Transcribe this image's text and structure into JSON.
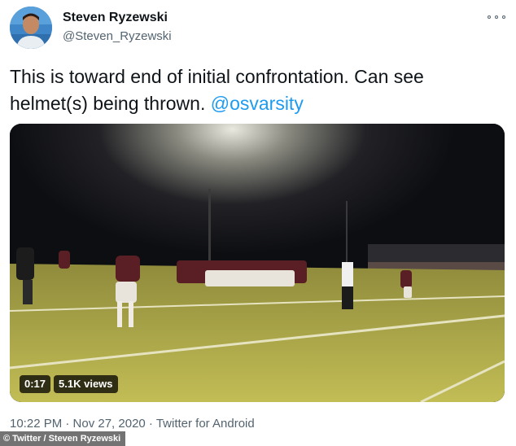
{
  "author": {
    "name": "Steven Ryzewski",
    "handle": "@Steven_Ryzewski",
    "avatar_icon": "profile-photo"
  },
  "tweet": {
    "text": "This is toward end of initial confrontation. Can see helmet(s) being thrown.",
    "mention": "@osvarsity"
  },
  "video": {
    "duration": "0:17",
    "views": "5.1K views"
  },
  "meta": {
    "timestamp": "10:22 PM · Nov 27, 2020 · Twitter for Android"
  },
  "credit": "© Twitter / Steven Ryzewski",
  "colors": {
    "link": "#1d9bf0",
    "secondary_text": "#536471",
    "field_grass": "#b8b34a"
  }
}
